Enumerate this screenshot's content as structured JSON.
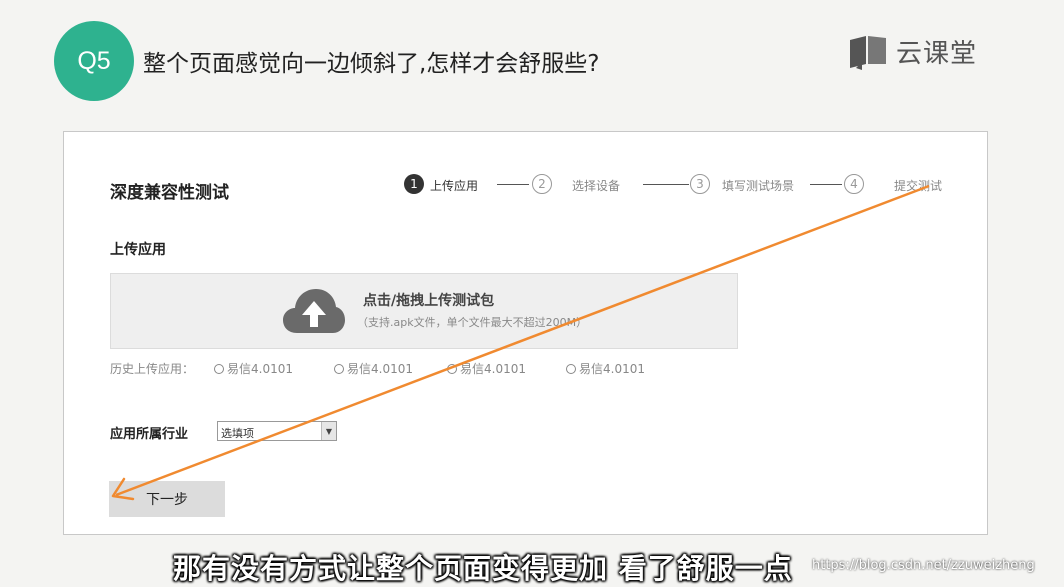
{
  "header": {
    "badge": "Q5",
    "question": "整个页面感觉向一边倾斜了,怎样才会舒服些?",
    "brand": "云课堂"
  },
  "form": {
    "title": "深度兼容性测试",
    "steps": [
      {
        "num": "1",
        "label": "上传应用",
        "state": "active"
      },
      {
        "num": "2",
        "label": "选择设备",
        "state": "idle"
      },
      {
        "num": "3",
        "label": "填写测试场景",
        "state": "idle"
      },
      {
        "num": "4",
        "label": "提交测试",
        "state": "idle"
      }
    ],
    "upload_section_label": "上传应用",
    "upload": {
      "title": "点击/拖拽上传测试包",
      "hint": "（支持.apk文件，单个文件最大不超过200M）",
      "icon": "cloud-upload-icon"
    },
    "history": {
      "label": "历史上传应用：",
      "items": [
        "易信4.0101",
        "易信4.0101",
        "易信4.0101",
        "易信4.0101"
      ]
    },
    "industry": {
      "label": "应用所属行业",
      "select_value": "选填项"
    },
    "next_button": "下一步"
  },
  "annotation": {
    "arrow_color": "#f08a30"
  },
  "subtitle": "那有没有方式让整个页面变得更加 看了舒服一点",
  "watermark": "https://blog.csdn.net/zzuweizheng",
  "colors": {
    "badge": "#2eb28f",
    "page_bg": "#f4f4f2"
  }
}
